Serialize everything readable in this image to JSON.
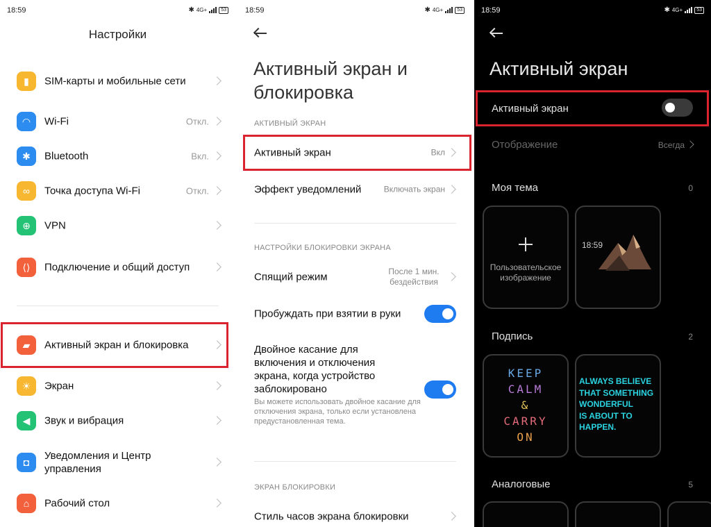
{
  "status": {
    "time": "18:59",
    "network": "4G+",
    "battery": "53"
  },
  "settings": {
    "title": "Настройки",
    "items": [
      {
        "label": "SIM-карты и мобильные сети",
        "value": "",
        "icon": "sim-card-icon",
        "color": "#f7b731"
      },
      {
        "label": "Wi-Fi",
        "value": "Откл.",
        "icon": "wifi-icon",
        "color": "#2d8cf0"
      },
      {
        "label": "Bluetooth",
        "value": "Вкл.",
        "icon": "bluetooth-icon",
        "color": "#2d8cf0"
      },
      {
        "label": "Точка доступа Wi-Fi",
        "value": "Откл.",
        "icon": "hotspot-icon",
        "color": "#f7b731"
      },
      {
        "label": "VPN",
        "value": "",
        "icon": "globe-icon",
        "color": "#23c275"
      },
      {
        "label": "Подключение и общий доступ",
        "value": "",
        "icon": "share-icon",
        "color": "#f2603c"
      },
      {
        "label": "Активный экран и блокировка",
        "value": "",
        "icon": "lock-icon",
        "color": "#f2603c"
      },
      {
        "label": "Экран",
        "value": "",
        "icon": "sun-icon",
        "color": "#f7b731"
      },
      {
        "label": "Звук и вибрация",
        "value": "",
        "icon": "sound-icon",
        "color": "#23c275"
      },
      {
        "label": "Уведомления и Центр управления",
        "value": "",
        "icon": "notification-icon",
        "color": "#2d8cf0"
      },
      {
        "label": "Рабочий стол",
        "value": "",
        "icon": "home-icon",
        "color": "#f2603c"
      }
    ]
  },
  "lockscreen": {
    "title": "Активный экран и блокировка",
    "section_active": "АКТИВНЫЙ ЭКРАН",
    "active_screen_label": "Активный экран",
    "active_screen_value": "Вкл",
    "notif_effect_label": "Эффект уведомлений",
    "notif_effect_value": "Включать экран",
    "section_lock_settings": "НАСТРОЙКИ БЛОКИРОВКИ ЭКРАНА",
    "sleep_label": "Спящий режим",
    "sleep_value": "После 1 мин. бездействия",
    "wake_label": "Пробуждать при взятии в руки",
    "doubletap_label": "Двойное касание для включения и отключения экрана, когда устройство заблокировано",
    "doubletap_desc": "Вы можете использовать двойное касание для отключения экрана, только если установлена предустановленная тема.",
    "section_lockscreen": "ЭКРАН БЛОКИРОВКИ",
    "clock_style_label": "Стиль часов экрана блокировки"
  },
  "aod": {
    "title": "Активный экран",
    "toggle_label": "Активный экран",
    "display_label": "Отображение",
    "display_value": "Всегда",
    "my_theme_label": "Моя тема",
    "my_theme_count": "0",
    "custom_image_label": "Пользовательское изображение",
    "clock_preview": "18:59",
    "signature_label": "Подпись",
    "signature_count": "2",
    "keep_calm": [
      "KEEP",
      "CALM",
      "&",
      "CARRY",
      "ON"
    ],
    "always_believe": [
      "ALWAYS BELIEVE",
      "THAT SOMETHING",
      "WONDERFUL",
      "IS ABOUT TO",
      "HAPPEN."
    ],
    "analog_label": "Аналоговые",
    "analog_count": "5"
  }
}
